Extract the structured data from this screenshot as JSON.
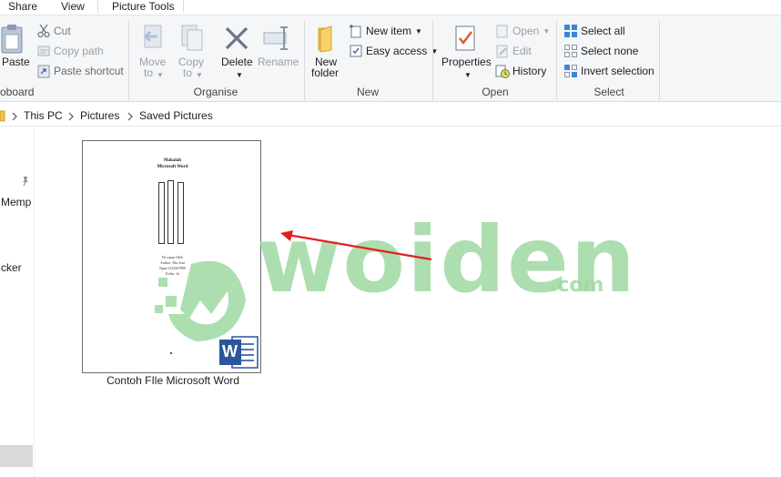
{
  "tabs": {
    "share": "Share",
    "view": "View",
    "picture_tools": "Picture Tools"
  },
  "clipboard": {
    "paste": "Paste",
    "cut": "Cut",
    "copy_path": "Copy path",
    "paste_shortcut": "Paste shortcut",
    "label": "oboard"
  },
  "organise": {
    "move_to_1": "Move",
    "move_to_2": "to",
    "copy_to_1": "Copy",
    "copy_to_2": "to",
    "delete": "Delete",
    "rename": "Rename",
    "label": "Organise"
  },
  "new": {
    "new_folder_1": "New",
    "new_folder_2": "folder",
    "new_item": "New item",
    "easy_access": "Easy access",
    "label": "New"
  },
  "open": {
    "properties": "Properties",
    "open": "Open",
    "edit": "Edit",
    "history": "History",
    "label": "Open"
  },
  "select": {
    "select_all": "Select all",
    "select_none": "Select none",
    "invert_selection": "Invert selection",
    "label": "Select"
  },
  "address": {
    "crumbs": [
      "This PC",
      "Pictures",
      "Saved Pictures"
    ]
  },
  "navpane": {
    "items": [
      "Memp",
      "cker"
    ]
  },
  "file": {
    "name": "Contoh FIle Microsoft Word",
    "doc_line_1": "Makalah",
    "doc_line_2": "Microsoft Word",
    "doc_sub_1": "Di susun Oleh",
    "doc_sub_2": "Author: Eko Isni",
    "doc_sub_3": "Npm:1234567890",
    "doc_sub_4": "Kelas: 1a",
    "word_letter": "W"
  },
  "watermark": {
    "brand": "woiden",
    "suffix": ".com",
    "color": "#9fd9a3"
  },
  "colors": {
    "accent_word": "#2b579a",
    "arrow": "#e02020",
    "ribbon_bg": "#f5f6f7"
  }
}
